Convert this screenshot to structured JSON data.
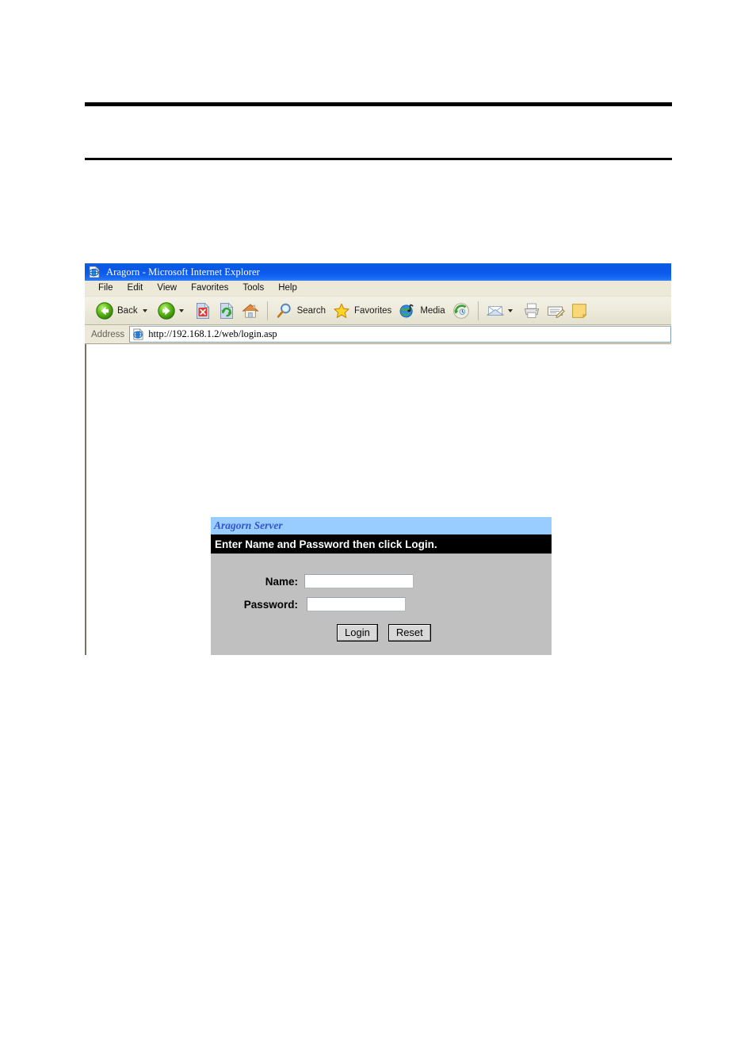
{
  "document": {
    "rules": [
      "thick-top-rule",
      "thin-bottom-rule"
    ]
  },
  "browser": {
    "title": "Aragorn - Microsoft Internet Explorer",
    "title_icon": "ie-document-icon",
    "menu": [
      {
        "label": "File"
      },
      {
        "label": "Edit"
      },
      {
        "label": "View"
      },
      {
        "label": "Favorites"
      },
      {
        "label": "Tools"
      },
      {
        "label": "Help"
      }
    ],
    "toolbar": {
      "back": {
        "label": "Back",
        "icon": "back-arrow-icon"
      },
      "forward": {
        "label": "",
        "icon": "forward-arrow-icon"
      },
      "stop": {
        "label": "",
        "icon": "stop-icon"
      },
      "refresh": {
        "label": "",
        "icon": "refresh-icon"
      },
      "home": {
        "label": "",
        "icon": "home-icon"
      },
      "search": {
        "label": "Search",
        "icon": "search-icon"
      },
      "favorites": {
        "label": "Favorites",
        "icon": "star-icon"
      },
      "media": {
        "label": "Media",
        "icon": "media-icon"
      },
      "history": {
        "label": "",
        "icon": "history-icon"
      },
      "mail": {
        "label": "",
        "icon": "mail-icon"
      },
      "print": {
        "label": "",
        "icon": "printer-icon"
      },
      "edit": {
        "label": "",
        "icon": "edit-page-icon"
      },
      "discuss": {
        "label": "",
        "icon": "notes-icon"
      }
    },
    "address": {
      "label": "Address",
      "icon": "ie-page-icon",
      "url": "http://192.168.1.2/web/login.asp",
      "placeholder": ""
    }
  },
  "page": {
    "brand": "Aragorn Server",
    "instruction": "Enter Name and Password then click Login.",
    "fields": [
      {
        "label": "Name:",
        "value": "",
        "placeholder": ""
      },
      {
        "label": "Password:",
        "value": "",
        "placeholder": ""
      }
    ],
    "buttons": [
      {
        "label": "Login"
      },
      {
        "label": "Reset"
      }
    ]
  },
  "colors": {
    "title_bar_blue": "#0b57e8",
    "brand_bg": "#99ccff",
    "brand_text": "#3355cc",
    "instruction_bg": "#000000",
    "panel_bg": "#c0c0c0",
    "chrome_bg": "#ece9d8"
  }
}
